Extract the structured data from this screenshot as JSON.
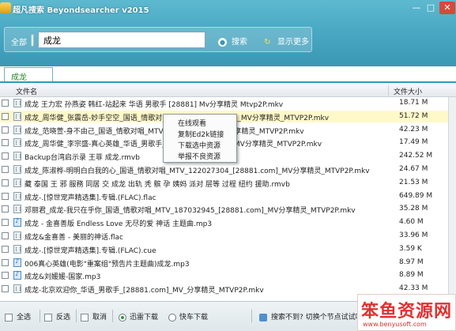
{
  "window": {
    "title": "超凡搜索 Beyondsearcher v2015",
    "min": "—",
    "max": "□",
    "close": "✕"
  },
  "search": {
    "scope_label": "全部",
    "query": "成龙",
    "search_label": "搜索",
    "more_label": "显示更多",
    "search_icon": "magnifier-icon",
    "more_icon": "refresh-arrow-icon"
  },
  "tabs": [
    {
      "label": "成龙"
    }
  ],
  "table": {
    "headers": {
      "name": "文件名",
      "size": "文件大小"
    },
    "rows": [
      {
        "name": "成龙 王力宏 孙燕姿 韩红-站起来 华语 男歌手 [28881] Mv分享精灵 Mtvp2P.mkv",
        "size": "18.71 M",
        "icon": "video"
      },
      {
        "name": "成龙_周华健_张震岳-妙手空空_国语_情歌对唱_MTV_[28881.com]_MV分享精灵_MTVP2P.mkv",
        "size": "51.72 M",
        "icon": "video"
      },
      {
        "name": "成龙_范晓萱-身不由己_国语_情歌对唱_MTV_[28881.com]_MV分享精灵_MTVP2P.mkv",
        "size": "42.23 M",
        "icon": "video"
      },
      {
        "name": "成龙_周华健_李宗盛-真心英雄_华语_男歌手_MTV_[28881.com]_MV分享精灵_MTVP2P.mkv",
        "size": "17.49 M",
        "icon": "video"
      },
      {
        "name": "Backup台湾启示录 王菲 成龙.rmvb",
        "size": "242.52 M",
        "icon": "video"
      },
      {
        "name": "成龙_陈淑桦-明明白白我的心_国语_情歌对唱_MTV_122027304_[28881.com]_MV分享精灵_MTVP2P.mkv",
        "size": "24.67 M",
        "icon": "video"
      },
      {
        "name": "藏 泰国 王 邪 服務 同居 交 成龙 出轨 秃 髌 孕 姨妈 派对 层等 过程 纽约 援助.rmvb",
        "size": "21.53 M",
        "icon": "video"
      },
      {
        "name": "成龙-.[惊世宠声精选集].专辑.(FLAC).flac",
        "size": "649.89 M",
        "icon": "video"
      },
      {
        "name": "邓丽君_成龙-我只在乎你_国语_情歌对唱_MTV_187032945_[28881.com]_MV分享精灵_MTVP2P.mkv",
        "size": "35.28 M",
        "icon": "video"
      },
      {
        "name": "成龙 - 金喜善版 Endless Love 无尽的爱 神话 主题曲.mp3",
        "size": "4.60 M",
        "icon": "audio"
      },
      {
        "name": "成龙&金喜善 - 美丽的神话.flac",
        "size": "33.96 M",
        "icon": "video"
      },
      {
        "name": "成龙-.[惊世宠声精选集].专辑.(FLAC).cue",
        "size": "3.59 K",
        "icon": "video"
      },
      {
        "name": "006真心英雄(电影\"重案组\"预告片主题曲)成龙.mp3",
        "size": "8.97 M",
        "icon": "audio"
      },
      {
        "name": "成龙&刘媛媛-国家.mp3",
        "size": "8.89 M",
        "icon": "audio"
      },
      {
        "name": "成龙-北京欢迎你_华语_男歌手_[28881.com]_MV_分享精灵_MTVP2P.mkv",
        "size": "42.33 M",
        "icon": "video"
      }
    ]
  },
  "context_menu": [
    "在线观看",
    "复制Ed2k链接",
    "下载选中资源",
    "举报不良资源"
  ],
  "footer": {
    "select_all": "全选",
    "invert": "反选",
    "cancel": "取消",
    "xunlei": "迅雷下载",
    "kuaiche": "快车下载",
    "message": "搜索不到? 切换个节点试试吧!"
  },
  "watermark": {
    "text": "笨鱼资源网",
    "url": "www.benyusoft.com"
  }
}
